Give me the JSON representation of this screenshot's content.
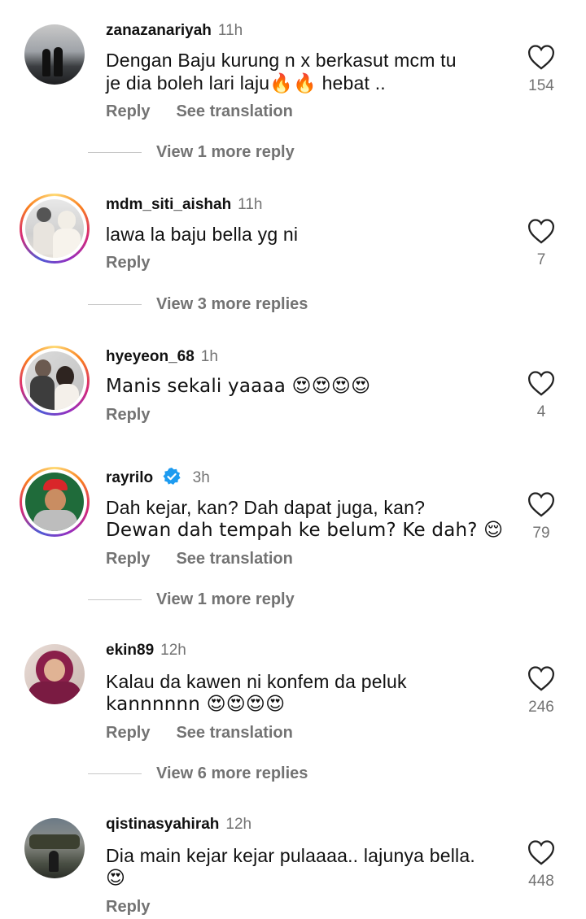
{
  "actions": {
    "reply": "Reply",
    "translate": "See translation"
  },
  "comments": [
    {
      "username": "zanazanariyah",
      "time": "11h",
      "text1": "Dengan Baju kurung n x berkasut mcm tu",
      "text2": "je dia boleh lari laju🔥🔥 hebat ..",
      "likes": "154",
      "more": "View 1 more reply"
    },
    {
      "username": "mdm_siti_aishah",
      "time": "11h",
      "text1": "lawa la baju bella yg ni",
      "text2": "",
      "likes": "7",
      "more": "View 3 more replies"
    },
    {
      "username": "hyeyeon_68",
      "time": "1h",
      "text1": "Manis sekali yaaaa 😍😍😍😍",
      "text2": "",
      "likes": "4",
      "more": ""
    },
    {
      "username": "rayrilo",
      "time": "3h",
      "text1": "Dah kejar, kan? Dah dapat juga, kan?",
      "text2": "Dewan dah tempah ke belum? Ke dah? 😌",
      "likes": "79",
      "more": "View 1 more reply"
    },
    {
      "username": "ekin89",
      "time": "12h",
      "text1": "Kalau da kawen ni konfem da peluk",
      "text2": "kannnnnn 😍😍😍😍",
      "likes": "246",
      "more": "View 6 more replies"
    },
    {
      "username": "qistinasyahirah",
      "time": "12h",
      "text1": "Dia main kejar kejar pulaaaa.. lajunya bella.",
      "text2": "😍",
      "likes": "448",
      "more": ""
    }
  ]
}
